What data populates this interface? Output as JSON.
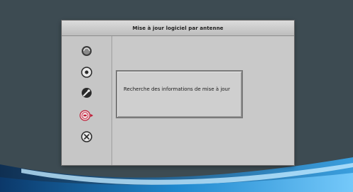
{
  "window": {
    "title": "Mise à jour logiciel par antenne"
  },
  "menu": {
    "items": [
      {
        "icon": "satellite-dish-icon",
        "selected": false
      },
      {
        "icon": "radio-target-icon",
        "selected": false
      },
      {
        "icon": "wrench-icon",
        "selected": false
      },
      {
        "icon": "software-update-icon",
        "selected": true
      },
      {
        "icon": "tools-settings-icon",
        "selected": false
      }
    ]
  },
  "info": {
    "message": "Recherche des informations de mise à jour"
  },
  "colors": {
    "background": "#3d4b52",
    "panel": "#c9c9c9",
    "selected_ring": "#c0203a",
    "icon_dark": "#2a2a2a",
    "swoosh_blue": "#1e8fd8"
  }
}
